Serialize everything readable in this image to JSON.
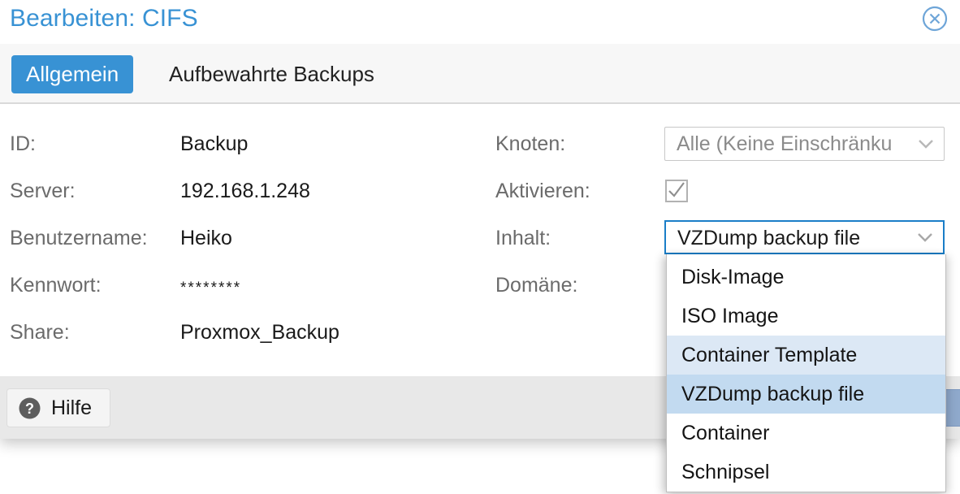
{
  "dialog": {
    "title": "Bearbeiten: CIFS",
    "close_icon": "close-circle-icon",
    "accent_color": "#3892d4",
    "focus_border_color": "#1a7ec8"
  },
  "tabs": [
    {
      "label": "Allgemein",
      "active": true
    },
    {
      "label": "Aufbewahrte Backups",
      "active": false
    }
  ],
  "form": {
    "left": [
      {
        "label": "ID:",
        "value": "Backup"
      },
      {
        "label": "Server:",
        "value": "192.168.1.248"
      },
      {
        "label": "Benutzername:",
        "value": "Heiko"
      },
      {
        "label": "Kennwort:",
        "value": "********"
      },
      {
        "label": "Share:",
        "value": "Proxmox_Backup"
      }
    ],
    "right": {
      "knoten": {
        "label": "Knoten:",
        "value": "Alle (Keine Einschränku",
        "icon": "chevron-down-icon"
      },
      "aktivieren": {
        "label": "Aktivieren:",
        "checked": true,
        "icon": "checkmark-icon"
      },
      "inhalt": {
        "label": "Inhalt:",
        "value": "VZDump backup file",
        "icon": "chevron-down-icon"
      },
      "domaene": {
        "label": "Domäne:",
        "value": ""
      }
    }
  },
  "dropdown": {
    "open": true,
    "hover_color": "#dce8f5",
    "selected_color": "#c2daf0",
    "options": [
      {
        "label": "Disk-Image",
        "state": "normal"
      },
      {
        "label": "ISO Image",
        "state": "normal"
      },
      {
        "label": "Container Template",
        "state": "hovered"
      },
      {
        "label": "VZDump backup file",
        "state": "selected"
      },
      {
        "label": "Container",
        "state": "normal"
      },
      {
        "label": "Schnipsel",
        "state": "normal"
      }
    ]
  },
  "footer": {
    "help_label": "Hilfe",
    "help_icon": "question-mark-circle-icon",
    "ok_button_color": "#8fa9cc"
  }
}
